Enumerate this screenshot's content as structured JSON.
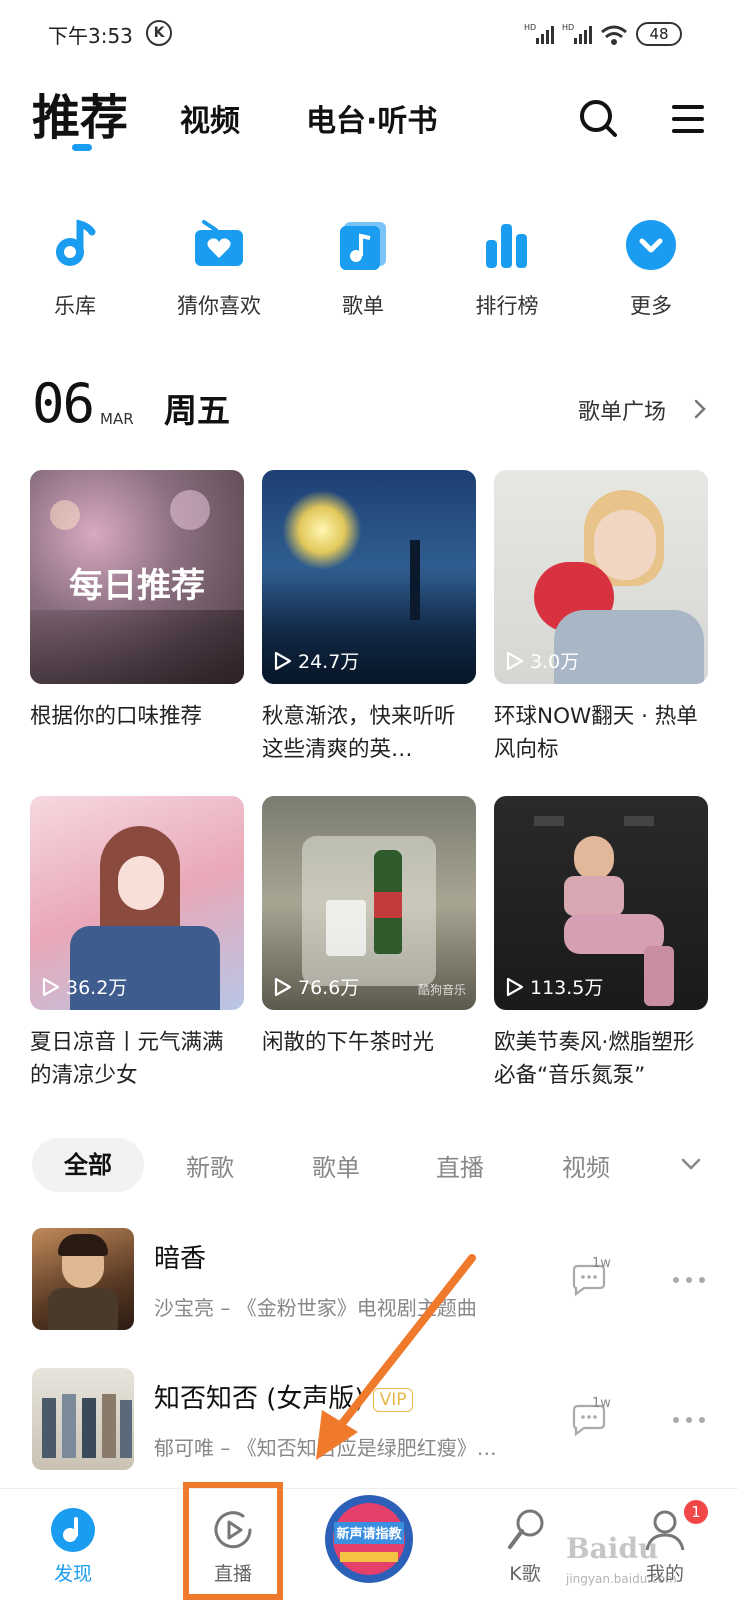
{
  "status_bar": {
    "time": "下午3:53",
    "k_badge": "K",
    "network_1": "HD",
    "network_2": "HD",
    "battery": "48"
  },
  "top_nav": {
    "tabs": [
      {
        "label": "推荐"
      },
      {
        "label": "视频"
      },
      {
        "label": "电台·听书"
      }
    ],
    "search_icon": "search-icon",
    "menu_icon": "menu-icon"
  },
  "quick_links": [
    {
      "label": "乐库",
      "icon": "music-note-icon"
    },
    {
      "label": "猜你喜欢",
      "icon": "radio-heart-icon"
    },
    {
      "label": "歌单",
      "icon": "playlist-icon"
    },
    {
      "label": "排行榜",
      "icon": "chart-bars-icon"
    },
    {
      "label": "更多",
      "icon": "chevron-circle-icon"
    }
  ],
  "date_header": {
    "day": "06",
    "month": "MAR",
    "weekday": "周五",
    "link": "歌单广场"
  },
  "cards": [
    {
      "overlay": "每日推荐",
      "play_count": "",
      "caption": "根据你的口味推荐"
    },
    {
      "overlay": "",
      "play_count": "24.7万",
      "caption": "秋意渐浓，快来听听这些清爽的英…"
    },
    {
      "overlay": "",
      "play_count": "3.0万",
      "caption": "环球NOW翻天 · 热单风向标"
    },
    {
      "overlay": "",
      "play_count": "36.2万",
      "caption": "夏日凉音丨元气满满的清凉少女"
    },
    {
      "overlay": "",
      "play_count": "76.6万",
      "caption": "闲散的下午茶时光"
    },
    {
      "overlay": "",
      "play_count": "113.5万",
      "caption": "欧美节奏风·燃脂塑形必备“音乐氮泵”"
    }
  ],
  "card_watermark": "酷狗音乐",
  "filters": [
    {
      "label": "全部"
    },
    {
      "label": "新歌"
    },
    {
      "label": "歌单"
    },
    {
      "label": "直播"
    },
    {
      "label": "视频"
    }
  ],
  "songs": [
    {
      "title": "暗香",
      "vip": "",
      "subtitle": "沙宝亮 – 《金粉世家》电视剧主题曲",
      "comment_count": "1w"
    },
    {
      "title": "知否知否 (女声版)",
      "vip": "VIP",
      "subtitle": "郁可唯 – 《知否知否应是绿肥红瘦》…",
      "comment_count": "1w"
    }
  ],
  "bottom_nav": [
    {
      "label": "发现",
      "active": true
    },
    {
      "label": "直播",
      "active": false
    },
    {
      "label": "",
      "active": false
    },
    {
      "label": "K歌",
      "active": false
    },
    {
      "label": "我的",
      "active": false
    }
  ],
  "notification_badge": "1",
  "disc_text": "新声请指教",
  "watermark": {
    "brand": "Baidu",
    "site": "jingyan.baidu.com"
  },
  "colors": {
    "accent": "#1a9cf0",
    "highlight": "#f07a2c",
    "badge": "#f04848"
  }
}
